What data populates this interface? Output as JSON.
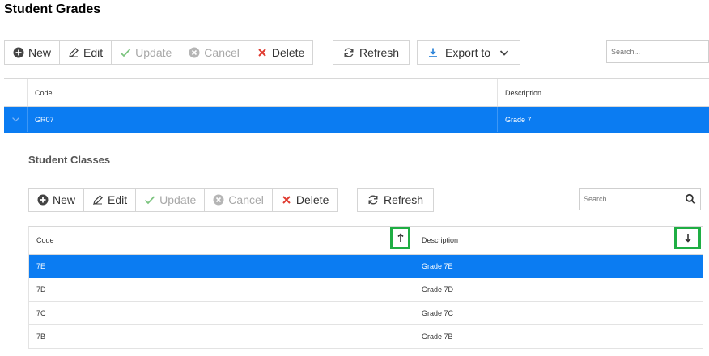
{
  "page": {
    "title": "Student Grades"
  },
  "main_toolbar": {
    "new": "New",
    "edit": "Edit",
    "update": "Update",
    "cancel": "Cancel",
    "delete": "Delete",
    "refresh": "Refresh",
    "export": "Export to"
  },
  "main_search": {
    "placeholder": "Search..."
  },
  "grades_grid": {
    "headers": {
      "code": "Code",
      "description": "Description"
    },
    "rows": [
      {
        "code": "GR07",
        "description": "Grade 7",
        "selected": true,
        "expanded": true
      }
    ]
  },
  "detail": {
    "title": "Student Classes",
    "toolbar": {
      "new": "New",
      "edit": "Edit",
      "update": "Update",
      "cancel": "Cancel",
      "delete": "Delete",
      "refresh": "Refresh"
    },
    "search": {
      "placeholder": "Search..."
    },
    "grid": {
      "headers": {
        "code": "Code",
        "description": "Description"
      },
      "sort": {
        "code": "ascending",
        "description": "descending"
      },
      "rows": [
        {
          "code": "7E",
          "description": "Grade 7E",
          "selected": true
        },
        {
          "code": "7D",
          "description": "Grade 7D"
        },
        {
          "code": "7C",
          "description": "Grade 7C"
        },
        {
          "code": "7B",
          "description": "Grade 7B"
        }
      ]
    }
  },
  "colors": {
    "selection": "#0b7cf2",
    "highlight": "#1fae44",
    "delete": "#e03a2f",
    "update": "#4caf50",
    "export": "#1e7bd6"
  }
}
